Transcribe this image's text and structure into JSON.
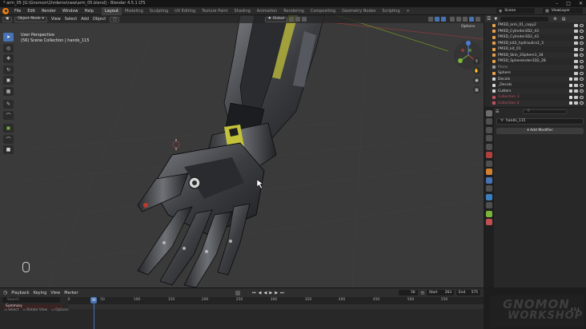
{
  "window": {
    "title": "* arm_05 [G:\\Gnomon\\1hrdemo\\new\\arm_05.blend] - Blender 4.5.1 LTS"
  },
  "menu": [
    "File",
    "Edit",
    "Render",
    "Window",
    "Help"
  ],
  "workspaces": [
    {
      "label": "Layout",
      "active": true
    },
    {
      "label": "Modeling"
    },
    {
      "label": "Sculpting"
    },
    {
      "label": "UV Editing"
    },
    {
      "label": "Texture Paint"
    },
    {
      "label": "Shading"
    },
    {
      "label": "Animation"
    },
    {
      "label": "Rendering"
    },
    {
      "label": "Compositing"
    },
    {
      "label": "Geometry Nodes"
    },
    {
      "label": "Scripting"
    }
  ],
  "scene": {
    "label": "Scene"
  },
  "viewlayer": {
    "label": "ViewLayer"
  },
  "viewport": {
    "mode": "Object Mode",
    "menus": [
      "View",
      "Select",
      "Add",
      "Object"
    ],
    "orientation": "Global",
    "options": "Options",
    "info_line1": "User Perspective",
    "info_line2": "(56) Scene Collection | hands_115"
  },
  "outliner": {
    "rows": [
      {
        "label": "PM3D_arm_01_copy2",
        "color": "#e8a04a"
      },
      {
        "label": "PM3D_Cylinder3D2_43",
        "color": "#e8a04a"
      },
      {
        "label": "PM3D_Cylinder3D2_43",
        "color": "#e8a04a"
      },
      {
        "label": "PM3D_kit2_hydraulics1_3",
        "color": "#e8a04a"
      },
      {
        "label": "PM3D_kit_01",
        "color": "#e8a04a"
      },
      {
        "label": "PM3D_Skin_2Sphere1_34",
        "color": "#e8a04a"
      },
      {
        "label": "PM3D_Sphereinder3D2_28",
        "color": "#e8a04a"
      },
      {
        "label": "Plane",
        "color": "#9a9a9a"
      },
      {
        "label": "Sphere",
        "color": "#e8a04a"
      },
      {
        "label": "Decals",
        "color": "#d6d6d6"
      },
      {
        "label": "_Decals",
        "color": "#d6d6d6"
      },
      {
        "label": "Cutters",
        "color": "#d6d6d6"
      },
      {
        "label": "Collection 3",
        "color": "#c05060"
      },
      {
        "label": "Collection 2",
        "color": "#c05060"
      }
    ]
  },
  "properties": {
    "search_placeholder": "",
    "object_name": "hands_115",
    "add_modifier": "Add Modifier"
  },
  "timeline": {
    "menus": [
      "Playback",
      "Keying",
      "View",
      "Marker"
    ],
    "search_placeholder": "Search",
    "summary": "Summary",
    "current_frame": "56",
    "start_label": "Start",
    "start_value": "263",
    "end_label": "End",
    "end_value": "575",
    "ticks": [
      "0",
      "50",
      "100",
      "150",
      "200",
      "250",
      "300",
      "350",
      "400",
      "450",
      "500",
      "550"
    ]
  },
  "statusbar": {
    "items": [
      "Select",
      "Rotate View",
      "Options"
    ]
  },
  "watermark": {
    "line1": "GNOMON",
    "line2": "WORKSHOP",
    "version": "4.5.1"
  }
}
